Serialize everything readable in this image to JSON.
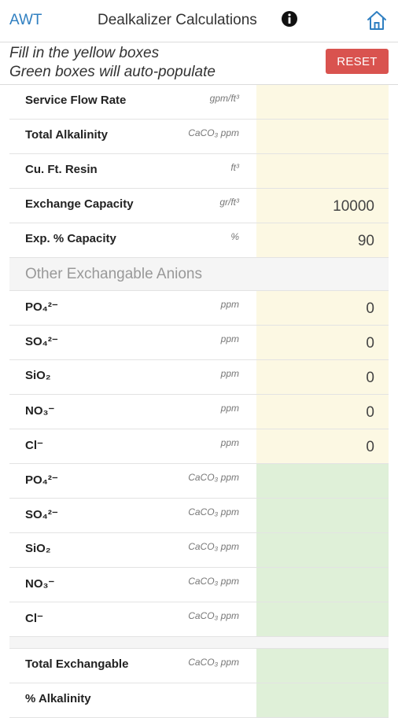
{
  "header": {
    "back_label": "AWT",
    "title": "Dealkalizer Calculations",
    "info_icon": "info-circle-icon",
    "home_icon": "home-icon"
  },
  "instructions": {
    "line1": "Fill in the yellow boxes",
    "line2": "Green boxes will auto-populate"
  },
  "reset_label": "RESET",
  "inputs": [
    {
      "label": "Service Flow Rate",
      "unit": "gpm/ft³",
      "value": ""
    },
    {
      "label": "Total Alkalinity",
      "unit": "CaCO₃ ppm",
      "value": ""
    },
    {
      "label": "Cu. Ft. Resin",
      "unit": "ft³",
      "value": ""
    },
    {
      "label": "Exchange Capacity",
      "unit": "gr/ft³",
      "value": "10000"
    },
    {
      "label": "Exp. % Capacity",
      "unit": "%",
      "value": "90"
    }
  ],
  "section_title": "Other Exchangable Anions",
  "anions_ppm": [
    {
      "label": "PO₄²⁻",
      "unit": "ppm",
      "value": "0"
    },
    {
      "label": "SO₄²⁻",
      "unit": "ppm",
      "value": "0"
    },
    {
      "label": "SiO₂",
      "unit": "ppm",
      "value": "0"
    },
    {
      "label": "NO₃⁻",
      "unit": "ppm",
      "value": "0"
    },
    {
      "label": "Cl⁻",
      "unit": "ppm",
      "value": "0"
    }
  ],
  "anions_caco3": [
    {
      "label": "PO₄²⁻",
      "unit": "CaCO₃ ppm",
      "value": ""
    },
    {
      "label": "SO₄²⁻",
      "unit": "CaCO₃ ppm",
      "value": ""
    },
    {
      "label": "SiO₂",
      "unit": "CaCO₃ ppm",
      "value": ""
    },
    {
      "label": "NO₃⁻",
      "unit": "CaCO₃ ppm",
      "value": ""
    },
    {
      "label": "Cl⁻",
      "unit": "CaCO₃ ppm",
      "value": ""
    }
  ],
  "results": [
    {
      "label": "Total Exchangable",
      "unit": "CaCO₃ ppm",
      "value": ""
    },
    {
      "label": "% Alkalinity",
      "unit": "",
      "value": ""
    }
  ],
  "colors": {
    "link": "#2f7fc1",
    "reset": "#d9534f",
    "input_cell": "#fcf8e3",
    "output_cell": "#dff0d8"
  }
}
